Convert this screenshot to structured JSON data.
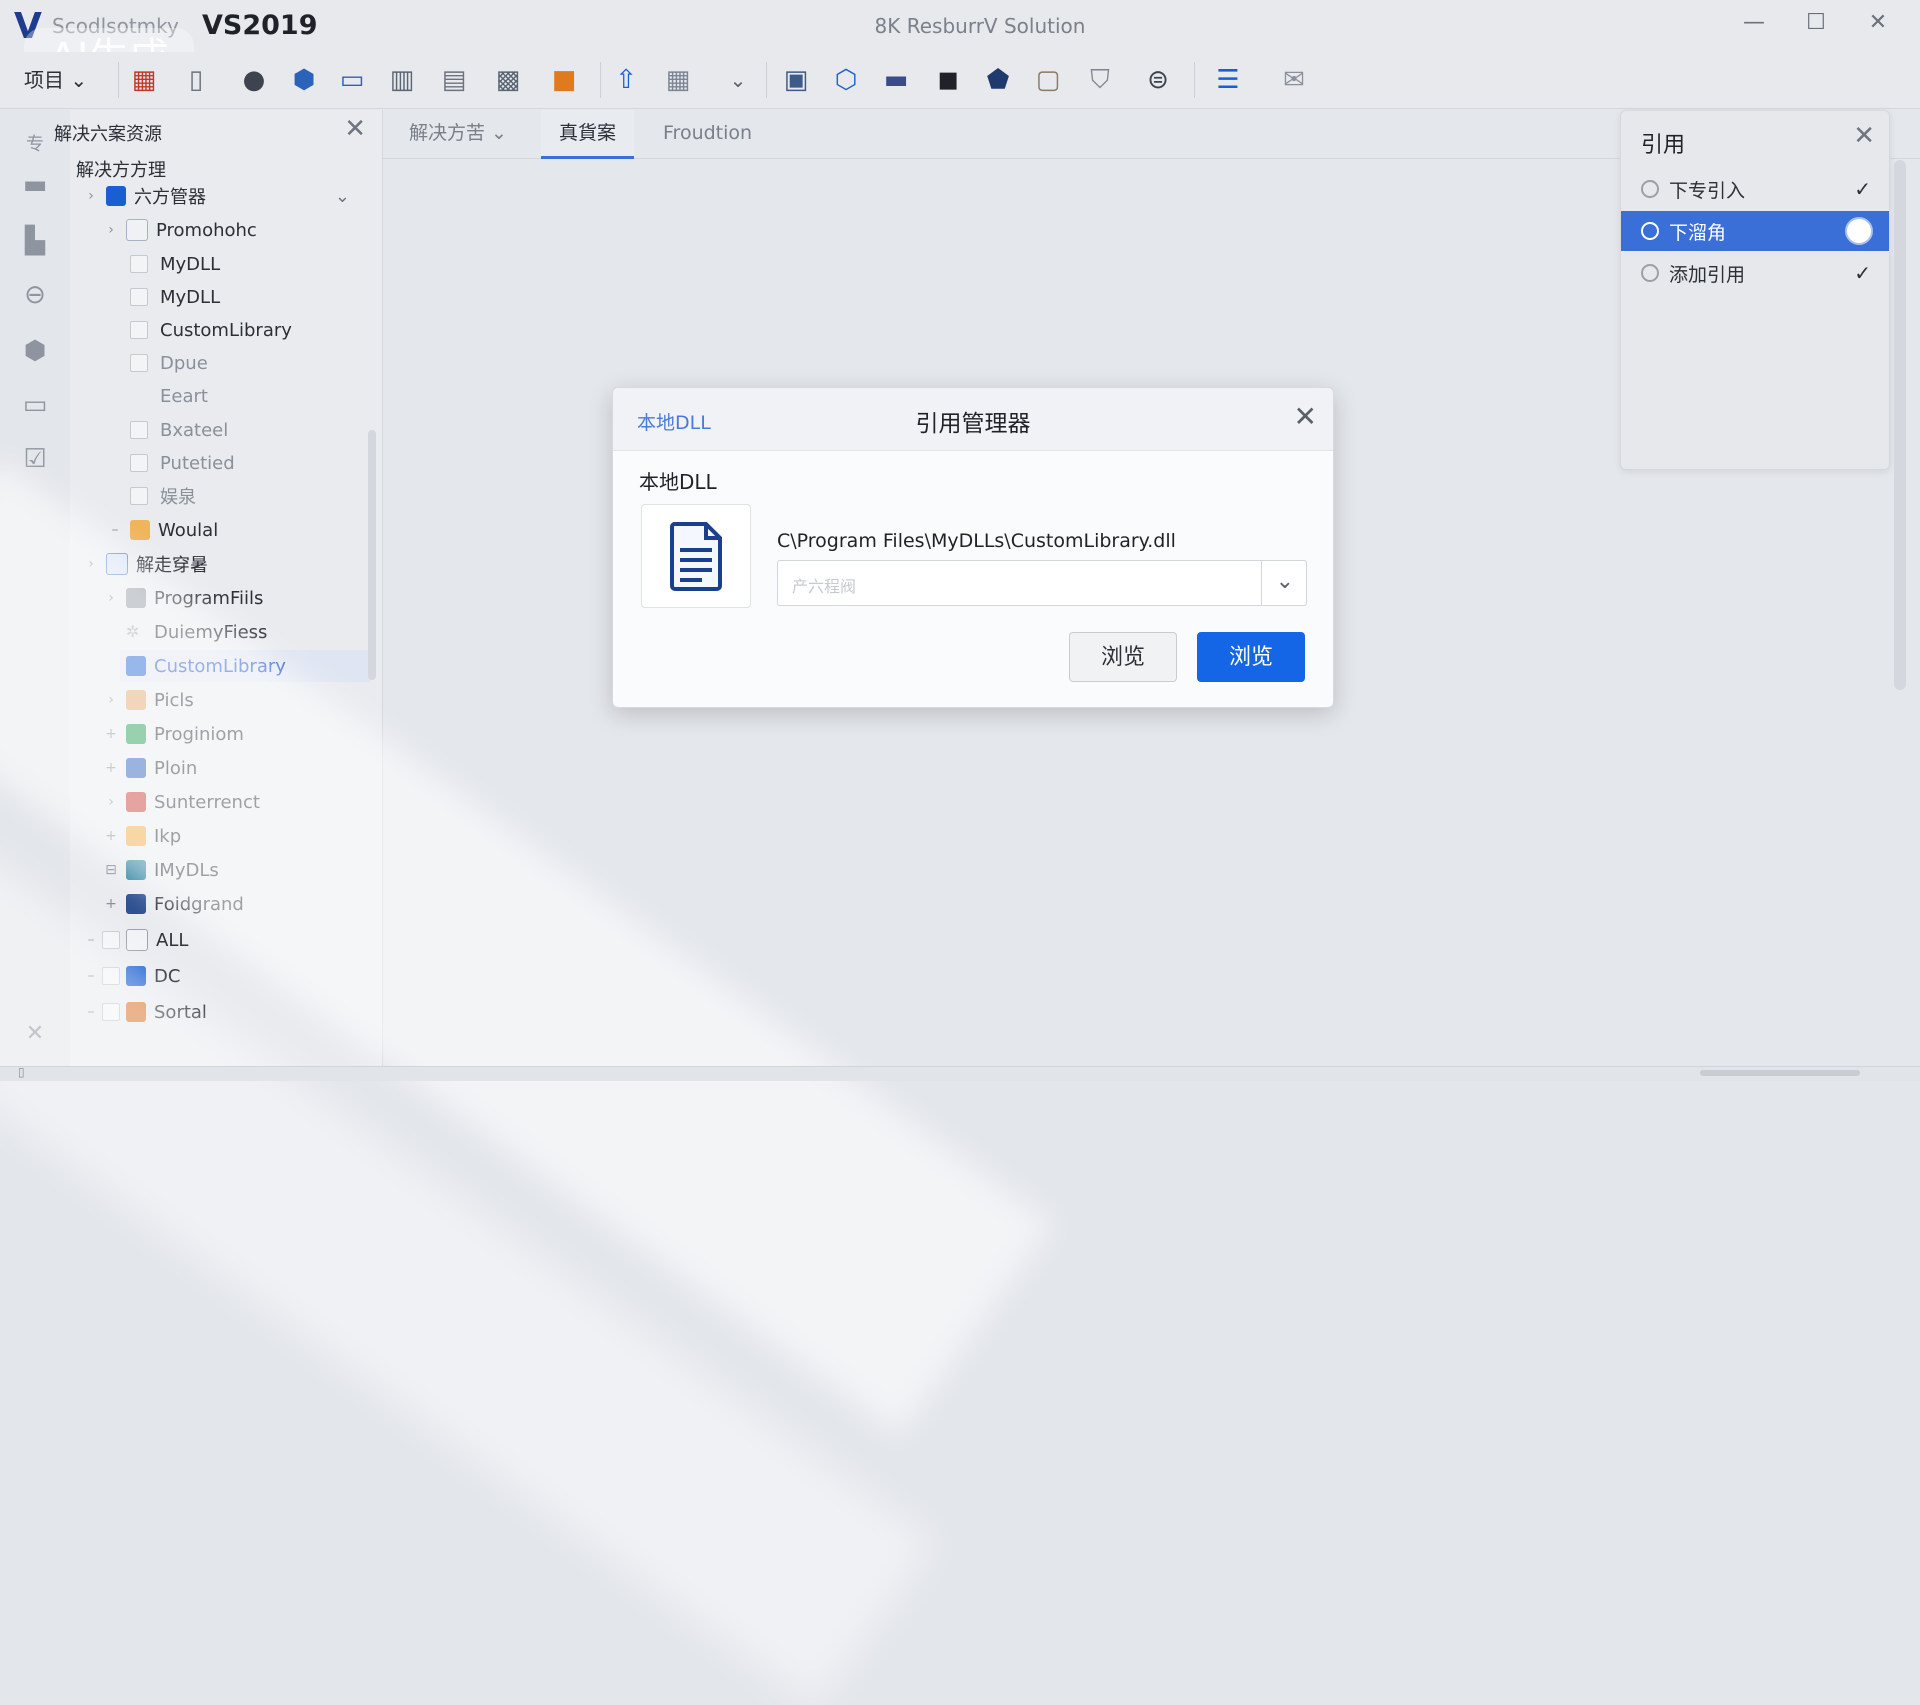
{
  "app": {
    "logo_letter": "V",
    "name": "Scodlsotmky",
    "version": "VS2019",
    "window_title": "8K ResburrV Solution",
    "watermark": "AI生成"
  },
  "window_controls": {
    "minimize": "—",
    "maximize": "☐",
    "close": "✕"
  },
  "toolbar": {
    "project_menu": "项目 ⌄"
  },
  "explorer": {
    "title": "解决六案资源",
    "subtitle": "解决方方理",
    "close": "✕",
    "items": [
      {
        "label": "六方管器",
        "twisty": "›"
      },
      {
        "label": "Promohohc",
        "twisty": "›"
      },
      {
        "label": "MyDLL"
      },
      {
        "label": "MyDLL"
      },
      {
        "label": "CustomLibrary"
      },
      {
        "label": "Dpue"
      },
      {
        "label": "Eeart"
      },
      {
        "label": "Bxateel"
      },
      {
        "label": "Putetied"
      },
      {
        "label": "娱泉"
      },
      {
        "label": "Woulal",
        "twisty": "–"
      },
      {
        "label": "解走穿暑",
        "twisty": "›"
      },
      {
        "label": "ProgramFiils",
        "twisty": "›"
      },
      {
        "label": "DuiemyFiess"
      },
      {
        "label": "CustomLibrary"
      },
      {
        "label": "Picls",
        "twisty": "›"
      },
      {
        "label": "Proginiom",
        "twisty": "+"
      },
      {
        "label": "Ploin",
        "twisty": "+"
      },
      {
        "label": "Sunterrenct",
        "twisty": "›"
      },
      {
        "label": "Ikp",
        "twisty": "+"
      },
      {
        "label": "IMyDLs",
        "twisty": "⊟"
      },
      {
        "label": "Foidgrand",
        "twisty": "+"
      },
      {
        "label": "ALL",
        "twisty": "–"
      },
      {
        "label": "DC",
        "twisty": "–"
      },
      {
        "label": "Sortal",
        "twisty": "–"
      }
    ]
  },
  "tabs": [
    {
      "label": "解决方苦 ⌄"
    },
    {
      "label": "真貨案"
    },
    {
      "label": "Froudtion"
    }
  ],
  "reference_panel": {
    "title": "引用",
    "close": "✕",
    "items": [
      {
        "label": "下专引入",
        "mark": "✓"
      },
      {
        "label": "下溜角",
        "mark": ""
      },
      {
        "label": "添加引用",
        "mark": "✓"
      }
    ]
  },
  "dialog": {
    "breadcrumb": "本地DLL",
    "title": "引用管理器",
    "close": "✕",
    "section_label": "本地DLL",
    "file_path": "C\\Program Files\\MyDLLs\\CustomLibrary.dll",
    "combo_placeholder": "产六程阀",
    "combo_arrow": "⌄",
    "browse_secondary": "浏览",
    "browse_primary": "浏览"
  },
  "colors": {
    "accent": "#1466e6",
    "selection": "#3a6fd8",
    "logo": "#1e3b8f"
  }
}
